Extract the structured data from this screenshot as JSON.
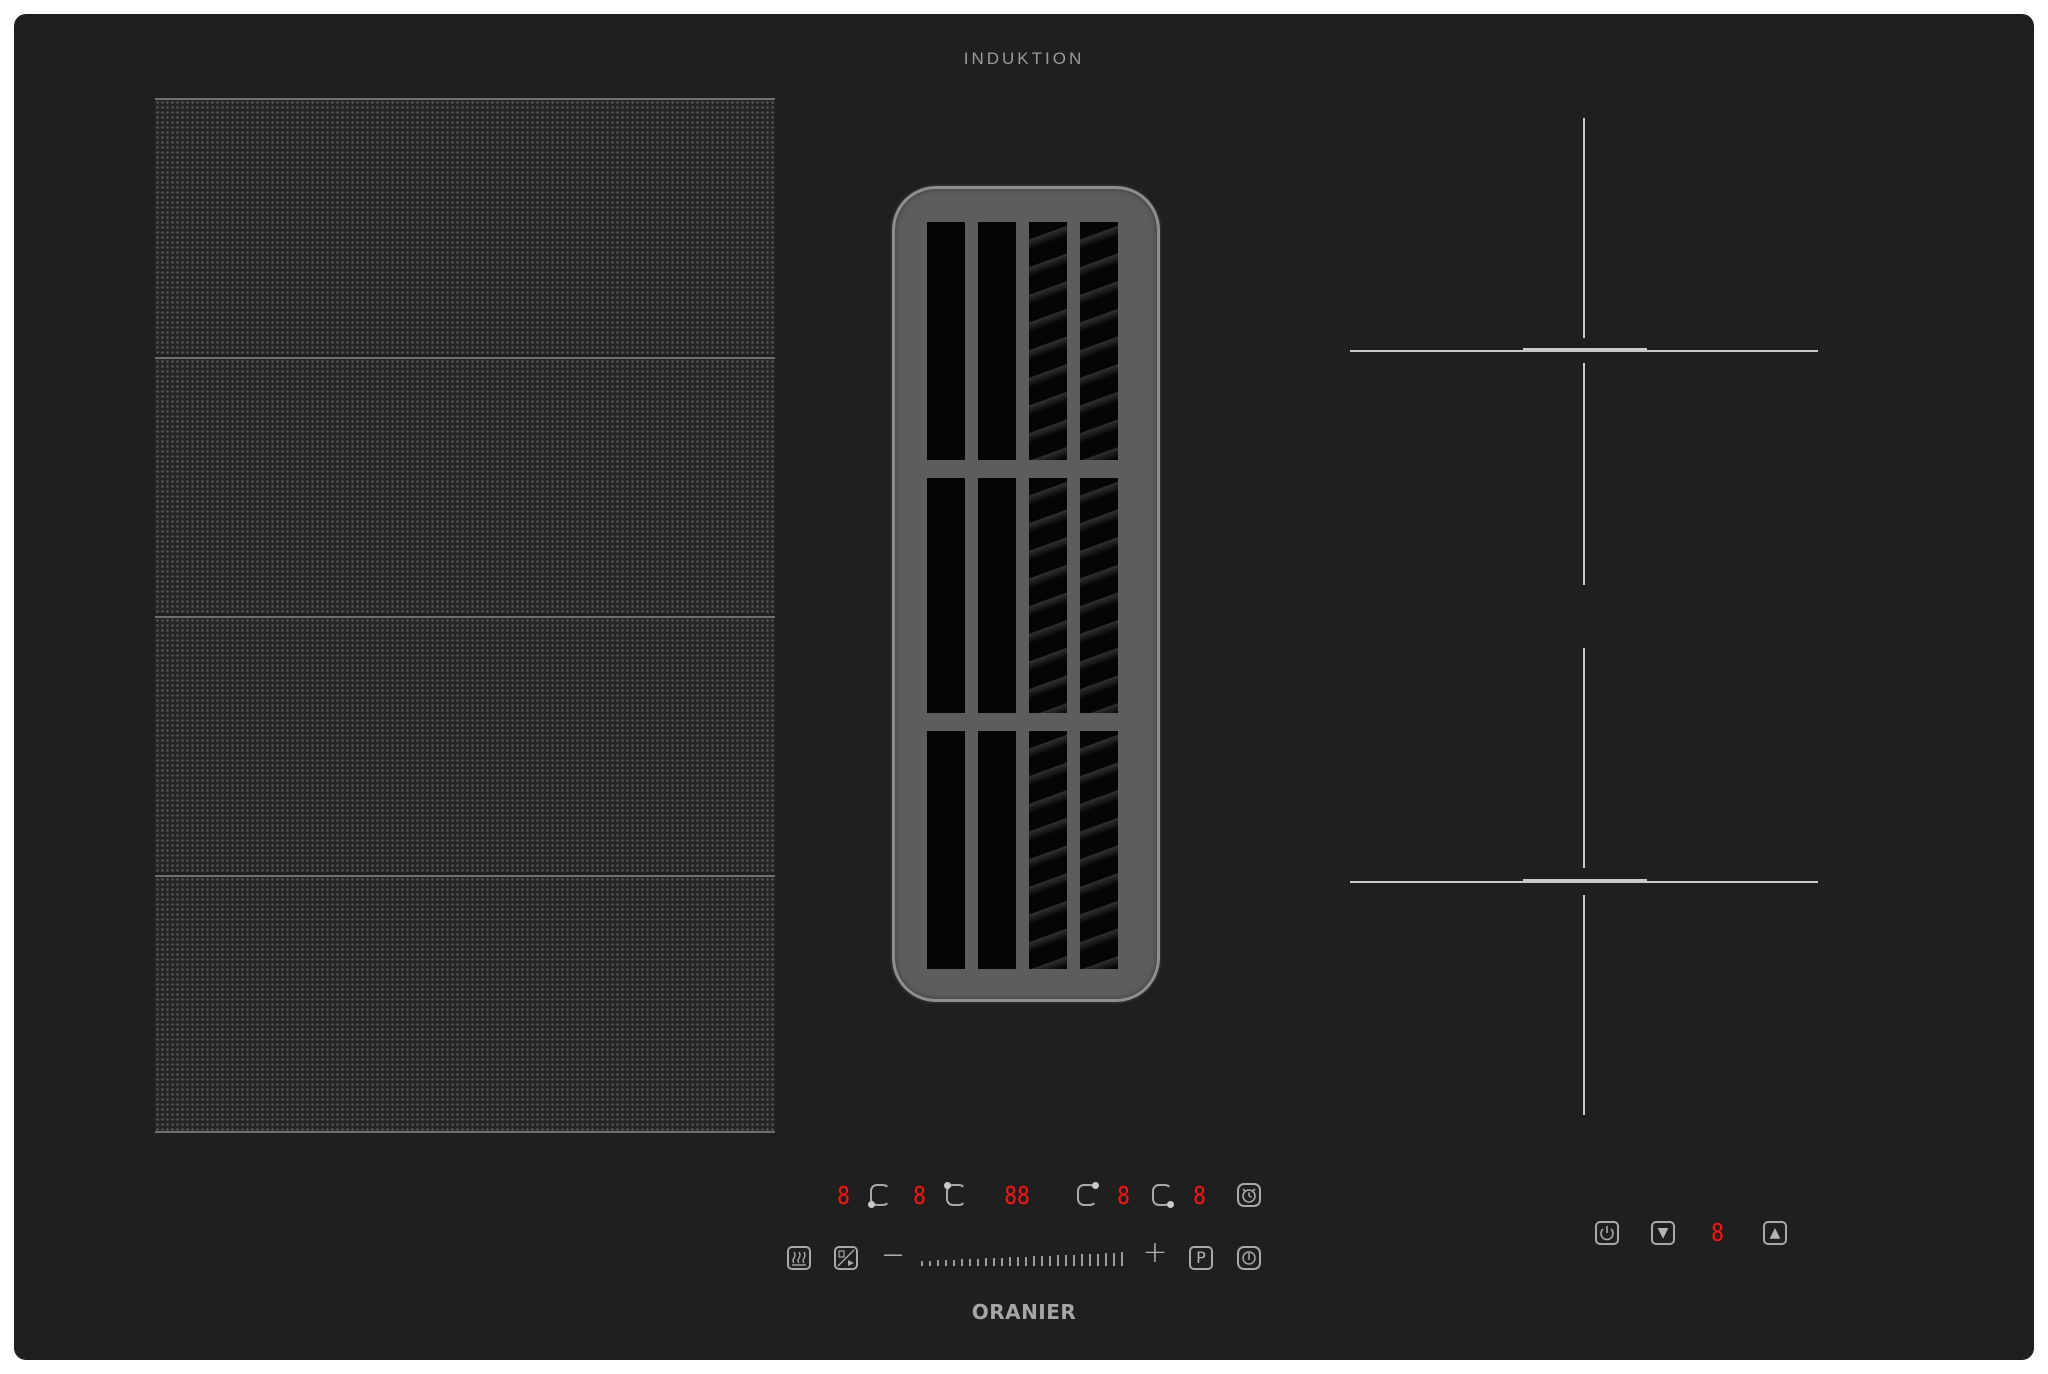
{
  "cooktop": {
    "brand_top": "INDUKTION",
    "brand_bottom": "ORANIER",
    "flex_zones": [
      "zone-1",
      "zone-2",
      "zone-3",
      "zone-4"
    ],
    "colors": {
      "glass": "#1f1f1f",
      "display": "#e01e1e",
      "vent_frame": "#5d5d5f",
      "markings": "#c9c9c9"
    }
  },
  "controls": {
    "cooktop_displays": [
      "8",
      "8",
      "88",
      "8",
      "8"
    ],
    "hood_display": "8",
    "icons": {
      "zone_select": "cooking-zone-select-icon",
      "timer": "timer-icon",
      "keep_warm": "keep-warm-icon",
      "bridge": "bridge-zone-icon",
      "minus": "minus-icon",
      "plus": "plus-icon",
      "power_boost": "power-boost-icon",
      "power": "power-icon",
      "hood_power": "hood-power-icon",
      "fan_down": "fan-down-icon",
      "fan_up": "fan-up-icon"
    },
    "symbols": {
      "minus": "—",
      "plus": "+",
      "power_boost": "P",
      "fan_down": "▼",
      "fan_up": "▲"
    }
  }
}
